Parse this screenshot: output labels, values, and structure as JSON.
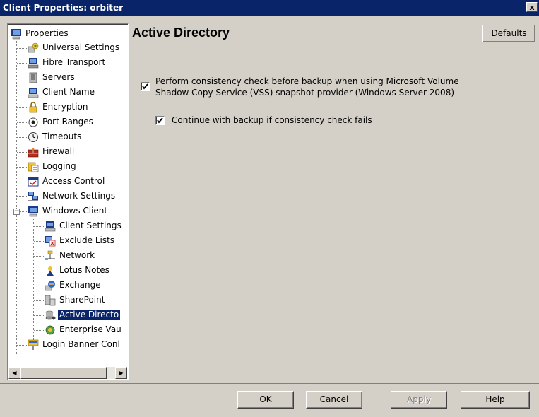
{
  "window": {
    "title": "Client Properties: orbiter",
    "close_glyph": "x"
  },
  "tree": {
    "root": "Properties",
    "items": [
      {
        "label": "Universal Settings"
      },
      {
        "label": "Fibre Transport"
      },
      {
        "label": "Servers"
      },
      {
        "label": "Client Name"
      },
      {
        "label": "Encryption"
      },
      {
        "label": "Port Ranges"
      },
      {
        "label": "Timeouts"
      },
      {
        "label": "Firewall"
      },
      {
        "label": "Logging"
      },
      {
        "label": "Access Control"
      },
      {
        "label": "Network Settings"
      },
      {
        "label": "Windows Client"
      }
    ],
    "windows_children": [
      {
        "label": "Client Settings"
      },
      {
        "label": "Exclude Lists"
      },
      {
        "label": "Network"
      },
      {
        "label": "Lotus Notes"
      },
      {
        "label": "Exchange"
      },
      {
        "label": "SharePoint"
      },
      {
        "label": "Active Directo"
      },
      {
        "label": "Enterprise Vau"
      }
    ],
    "last_item": "Login Banner Conl",
    "expander_glyph": "−",
    "scroll_left": "◀",
    "scroll_right": "▶"
  },
  "main": {
    "title": "Active Directory",
    "defaults_button": "Defaults",
    "checkbox1": {
      "line1": "Perform consistency check before backup when using Microsoft Volume",
      "line2": "Shadow Copy Service (VSS) snapshot provider (Windows Server 2008)",
      "checked": true
    },
    "checkbox2": {
      "label": "Continue with backup if consistency check fails",
      "checked": true
    }
  },
  "footer": {
    "ok": "OK",
    "cancel": "Cancel",
    "apply": "Apply",
    "help": "Help"
  }
}
